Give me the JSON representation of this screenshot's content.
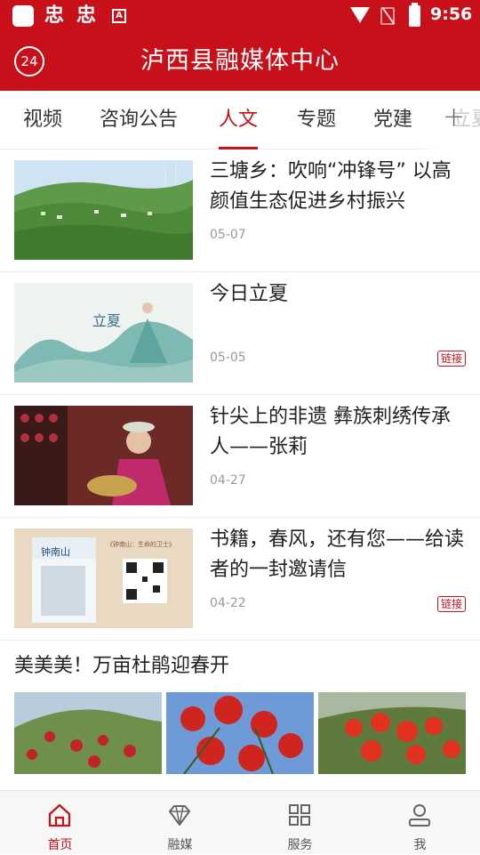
{
  "status_bar": {
    "time": "9:56",
    "notif_glyph": "忠",
    "a_glyph": "A",
    "icons": [
      "wifi-icon",
      "sim-off-icon",
      "battery-charging-icon"
    ]
  },
  "header": {
    "badge": "24",
    "title": "泸西县融媒体中心"
  },
  "tabs": [
    {
      "label": "视频"
    },
    {
      "label": "咨询公告"
    },
    {
      "label": "人文",
      "active": true
    },
    {
      "label": "专题"
    },
    {
      "label": "党建"
    }
  ],
  "tabs_overflow_ghost": "立夏",
  "news": [
    {
      "title": "三塘乡：吹响“冲锋号” 以高颜值生态促进乡村振兴",
      "date": "05-07",
      "tag": ""
    },
    {
      "title": "今日立夏",
      "date": "05-05",
      "tag": "链接"
    },
    {
      "title": "针尖上的非遗 彝族刺绣传承人——张莉",
      "date": "04-27",
      "tag": ""
    },
    {
      "title": "书籍，春风，还有您——给读者的一封邀请信",
      "date": "04-22",
      "tag": "链接"
    }
  ],
  "thumb_texts": {
    "lixia": "立夏",
    "book": "钟南山",
    "book_sub": "《钟南山：生命的卫士》"
  },
  "gallery": {
    "title": "美美美！万亩杜鹃迎春开"
  },
  "bottom_nav": [
    {
      "label": "首页",
      "icon": "home-icon",
      "active": true
    },
    {
      "label": "融媒",
      "icon": "diamond-icon"
    },
    {
      "label": "服务",
      "icon": "grid-icon"
    },
    {
      "label": "我",
      "icon": "user-icon"
    }
  ],
  "colors": {
    "brand": "#c8101a"
  }
}
